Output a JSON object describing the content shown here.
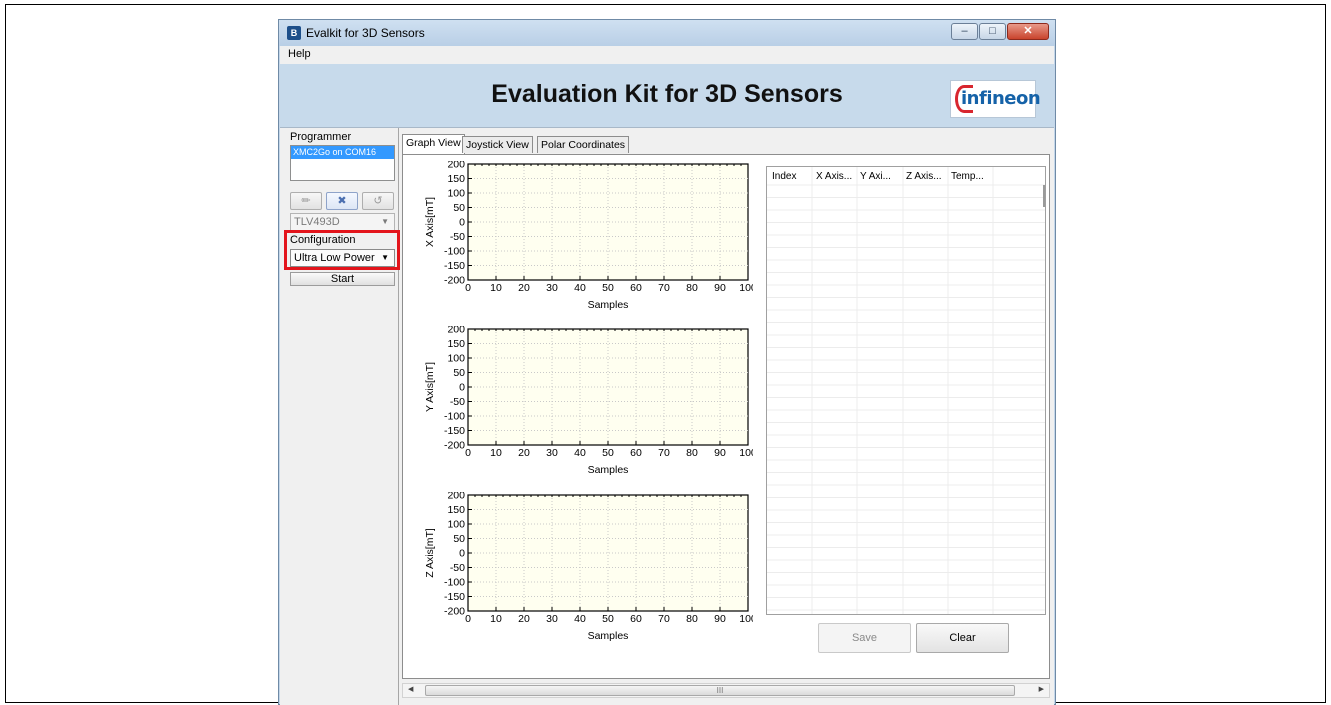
{
  "window": {
    "title": "Evalkit for 3D Sensors",
    "icon_letter": "B"
  },
  "menu": {
    "help": "Help"
  },
  "banner": {
    "title": "Evaluation Kit for 3D Sensors",
    "logo_text": "infineon"
  },
  "left_panel": {
    "programmer_label": "Programmer",
    "programmer_selected": "XMC2Go on COM16",
    "sensor_select": "TLV493D",
    "configuration_label": "Configuration",
    "configuration_value": "Ultra Low Power",
    "start_label": "Start"
  },
  "tabs": [
    "Graph View",
    "Joystick View",
    "Polar Coordinates"
  ],
  "graphs": [
    {
      "ylabel": "X Axis[mT]",
      "xlabel": "Samples"
    },
    {
      "ylabel": "Y Axis[mT]",
      "xlabel": "Samples"
    },
    {
      "ylabel": "Z Axis[mT]",
      "xlabel": "Samples"
    }
  ],
  "graph_axes": {
    "yticks": [
      "200",
      "150",
      "100",
      "50",
      "0",
      "-50",
      "-100",
      "-150",
      "-200"
    ],
    "xticks": [
      "0",
      "10",
      "20",
      "30",
      "40",
      "50",
      "60",
      "70",
      "80",
      "90",
      "100"
    ]
  },
  "table": {
    "columns": [
      "Index",
      "X Axis...",
      "Y Axi...",
      "Z Axis...",
      "Temp..."
    ]
  },
  "buttons": {
    "save": "Save",
    "clear": "Clear"
  },
  "scrollbar": {
    "thumb_grip": "III"
  }
}
